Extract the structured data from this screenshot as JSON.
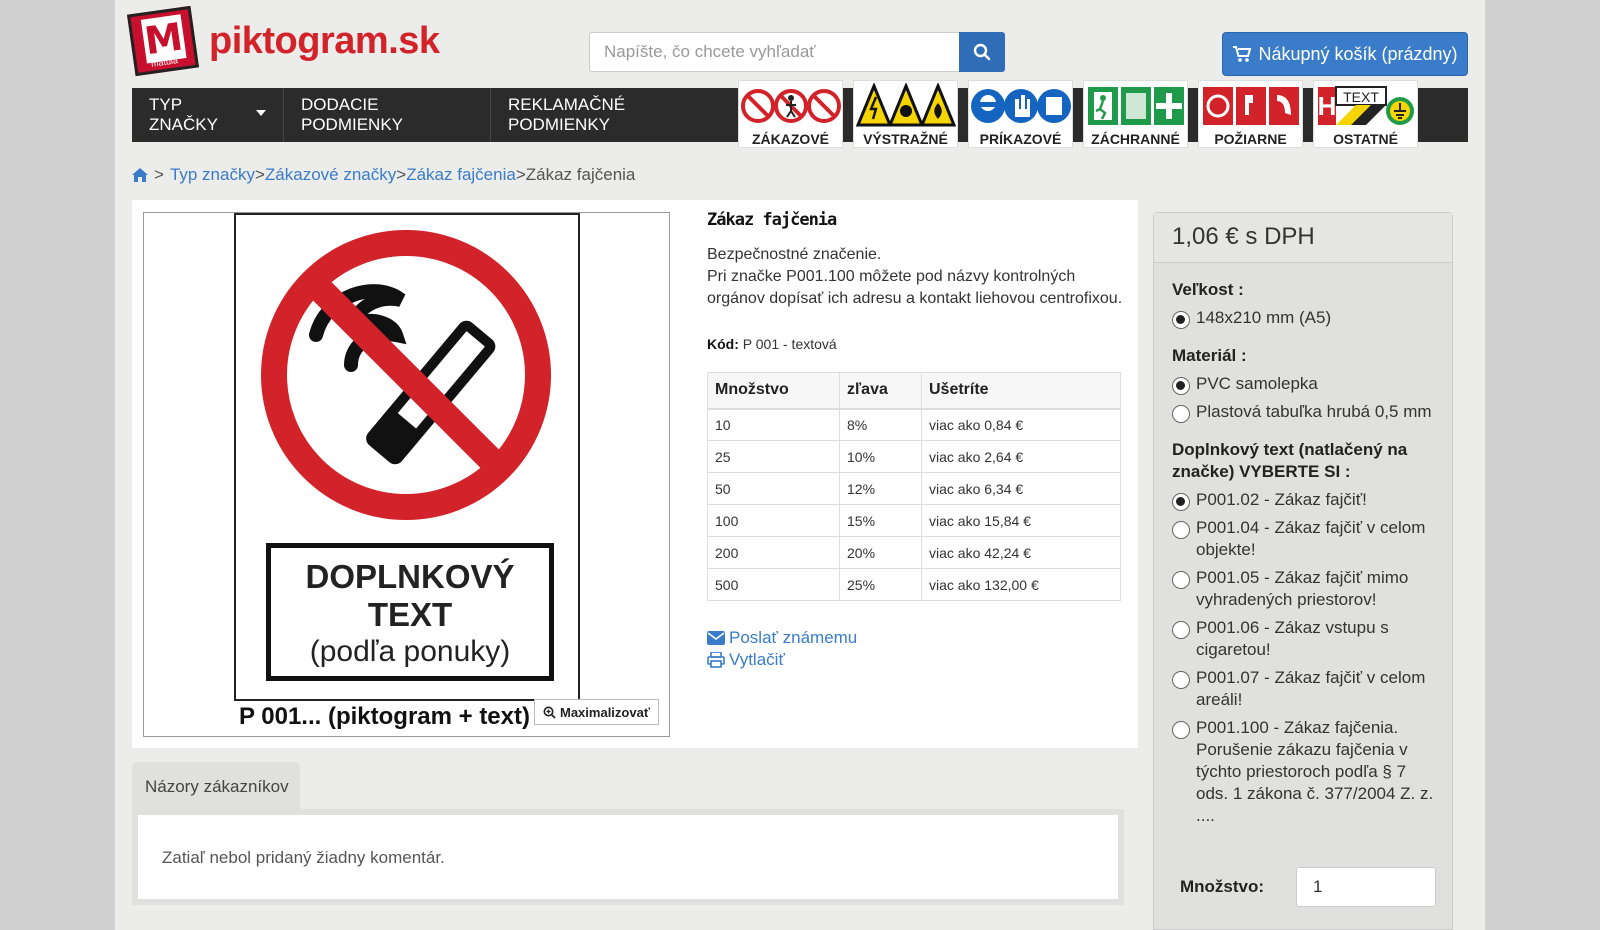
{
  "header": {
    "logo_text": "piktogram.sk",
    "logo_mark_letter": "M",
    "logo_mark_sub": "matula",
    "search_placeholder": "Napíšte, čo chcete vyhľadať",
    "cart_label": "Nákupný košík (prázdny)"
  },
  "nav": {
    "items": [
      "TYP ZNAČKY",
      "DODACIE PODMIENKY",
      "REKLAMAČNÉ PODMIENKY"
    ],
    "categories": [
      "ZÁKAZOVÉ",
      "VÝSTRAŽNÉ",
      "PRÍKAZOVÉ",
      "ZÁCHRANNÉ",
      "POŽIARNE",
      "OSTATNÉ"
    ],
    "category_other_pic_text": "TEXT"
  },
  "breadcrumb": {
    "sep": ">",
    "items": [
      "Typ značky",
      "Zákazové značky",
      "Zákaz fajčenia"
    ],
    "current": "Zákaz fajčenia"
  },
  "product": {
    "title": "Zákaz fajčenia",
    "desc_1": "Bezpečnostné značenie.",
    "desc_2": "Pri značke P001.100 môžete pod názvy kontrolných orgánov dopísať ich adresu a kontakt liehovou centrofixou.",
    "code_label": "Kód:",
    "code_value": "P 001 - textová",
    "sign_text_1": "DOPLNKOVÝ",
    "sign_text_2": "TEXT",
    "sign_text_3": "(podľa ponuky)",
    "image_caption": "P 001... (piktogram + text)",
    "maximize_label": "Maximalizovať",
    "send_label": "Poslať známemu",
    "print_label": "Vytlačiť"
  },
  "discount_table": {
    "headers": [
      "Množstvo",
      "zľava",
      "Ušetríte"
    ],
    "rows": [
      [
        "10",
        "8%",
        "viac ako 0,84 €"
      ],
      [
        "25",
        "10%",
        "viac ako 2,64 €"
      ],
      [
        "50",
        "12%",
        "viac ako 6,34 €"
      ],
      [
        "100",
        "15%",
        "viac ako 15,84 €"
      ],
      [
        "200",
        "20%",
        "viac ako 42,24 €"
      ],
      [
        "500",
        "25%",
        "viac ako 132,00 €"
      ]
    ]
  },
  "reviews": {
    "tab_label": "Názory zákazníkov",
    "empty_text": "Zatiaľ nebol pridaný žiadny komentár."
  },
  "panel": {
    "price": "1,06 € s DPH",
    "size_label": "Veľkost :",
    "size_options": [
      "148x210 mm (A5)"
    ],
    "material_label": "Materiál :",
    "material_options": [
      "PVC samolepka",
      "Plastová tabuľka hrubá 0,5 mm"
    ],
    "text_label": "Doplnkový text (natlačený na značke) VYBERTE SI :",
    "text_options": [
      "P001.02 - Zákaz fajčiť!",
      "P001.04 - Zákaz fajčiť v celom objekte!",
      "P001.05 - Zákaz fajčiť mimo vyhradených priestorov!",
      "P001.06 - Zákaz vstupu s cigaretou!",
      "P001.07 - Zákaz fajčiť v celom areáli!",
      "P001.100 - Zákaz fajčenia. Porušenie zákazu fajčenia v týchto priestoroch podľa § 7 ods. 1 zákona č. 377/2004 Z. z. ...."
    ],
    "qty_label": "Množstvo:",
    "qty_value": "1"
  },
  "colors": {
    "brand_red": "#d2232a",
    "link_blue": "#3a7cc9",
    "nav_bg": "#2b2b2b"
  }
}
